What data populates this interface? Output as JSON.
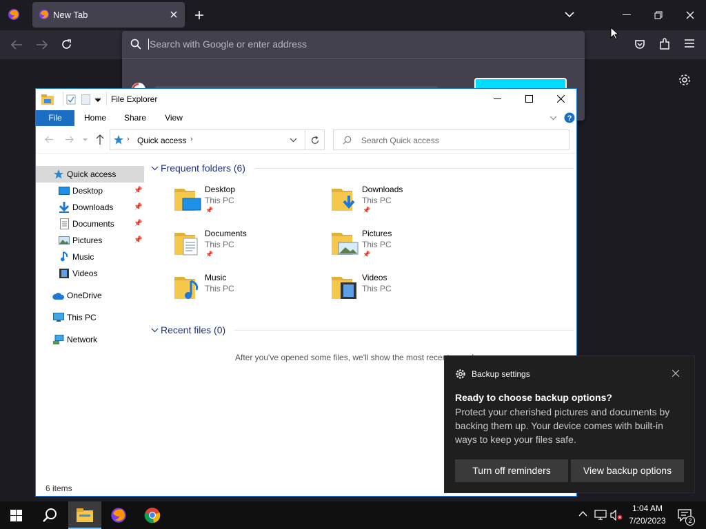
{
  "firefox": {
    "tab_title": "New Tab",
    "url_placeholder": "Search with Google or enter address"
  },
  "explorer": {
    "title": "File Explorer",
    "ribbon_tabs": [
      "File",
      "Home",
      "Share",
      "View"
    ],
    "address_location": "Quick access",
    "search_placeholder": "Search Quick access",
    "sidebar": {
      "quick_access": "Quick access",
      "pinned": [
        "Desktop",
        "Downloads",
        "Documents",
        "Pictures"
      ],
      "unpinned": [
        "Music",
        "Videos"
      ],
      "onedrive": "OneDrive",
      "this_pc": "This PC",
      "network": "Network"
    },
    "frequent_title": "Frequent folders (6)",
    "folders": [
      {
        "name": "Desktop",
        "location": "This PC",
        "pinned": true,
        "icon": "desktop-folder-icon"
      },
      {
        "name": "Downloads",
        "location": "This PC",
        "pinned": true,
        "icon": "downloads-folder-icon"
      },
      {
        "name": "Documents",
        "location": "This PC",
        "pinned": true,
        "icon": "documents-folder-icon"
      },
      {
        "name": "Pictures",
        "location": "This PC",
        "pinned": true,
        "icon": "pictures-folder-icon"
      },
      {
        "name": "Music",
        "location": "This PC",
        "pinned": false,
        "icon": "music-folder-icon"
      },
      {
        "name": "Videos",
        "location": "This PC",
        "pinned": false,
        "icon": "videos-folder-icon"
      }
    ],
    "recent_title": "Recent files (0)",
    "recent_empty": "After you've opened some files, we'll show the most recent ones here.",
    "status": "6 items"
  },
  "toast": {
    "app_name": "Backup settings",
    "heading": "Ready to choose backup options?",
    "body": "Protect your cherished pictures and documents by backing them up. Your device comes with built-in ways to keep your files safe.",
    "button_dismiss": "Turn off reminders",
    "button_view": "View backup options"
  },
  "taskbar": {
    "time": "1:04 AM",
    "date": "7/20/2023",
    "notification_count": "2"
  },
  "colors": {
    "accent": "#1a6fc4",
    "firefox_cyan": "#00ddff",
    "folder_yellow": "#f5c84c"
  }
}
